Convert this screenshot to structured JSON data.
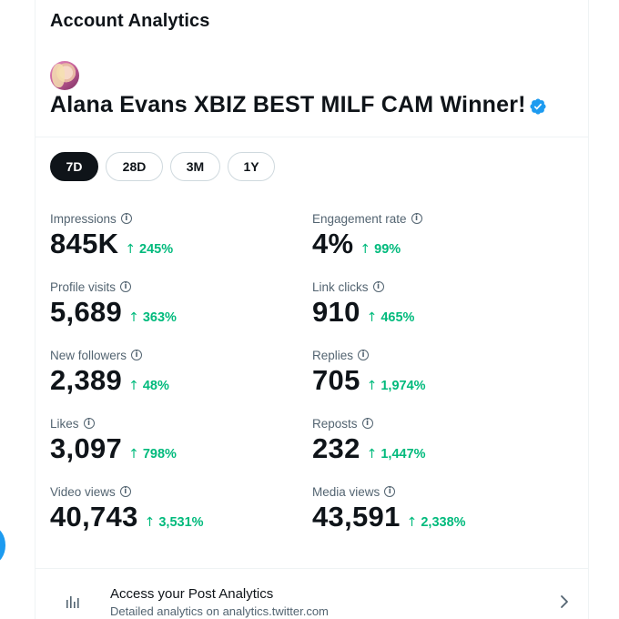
{
  "header": {
    "title": "Account Analytics"
  },
  "account": {
    "name": "Alana Evans XBIZ BEST MILF CAM Winner!",
    "verified": true,
    "verified_color": "#1d9bf0"
  },
  "time_ranges": [
    {
      "label": "7D",
      "active": true
    },
    {
      "label": "28D",
      "active": false
    },
    {
      "label": "3M",
      "active": false
    },
    {
      "label": "1Y",
      "active": false
    }
  ],
  "metrics": [
    {
      "label": "Impressions",
      "value": "845K",
      "change": "245%"
    },
    {
      "label": "Engagement rate",
      "value": "4%",
      "change": "99%"
    },
    {
      "label": "Profile visits",
      "value": "5,689",
      "change": "363%"
    },
    {
      "label": "Link clicks",
      "value": "910",
      "change": "465%"
    },
    {
      "label": "New followers",
      "value": "2,389",
      "change": "48%"
    },
    {
      "label": "Replies",
      "value": "705",
      "change": "1,974%"
    },
    {
      "label": "Likes",
      "value": "3,097",
      "change": "798%"
    },
    {
      "label": "Reposts",
      "value": "232",
      "change": "1,447%"
    },
    {
      "label": "Video views",
      "value": "40,743",
      "change": "3,531%"
    },
    {
      "label": "Media views",
      "value": "43,591",
      "change": "2,338%"
    }
  ],
  "icons": {
    "info": "info-icon",
    "trend": "arrow-up-icon",
    "link": "chevron-right-icon",
    "analytics": "bar-chart-icon"
  },
  "colors": {
    "positive_change": "#00ba7c",
    "active_tab_bg": "#0f1419",
    "brand_blue": "#1d9bf0"
  },
  "footer_link": {
    "title": "Access your Post Analytics",
    "subtitle": "Detailed analytics on analytics.twitter.com"
  }
}
